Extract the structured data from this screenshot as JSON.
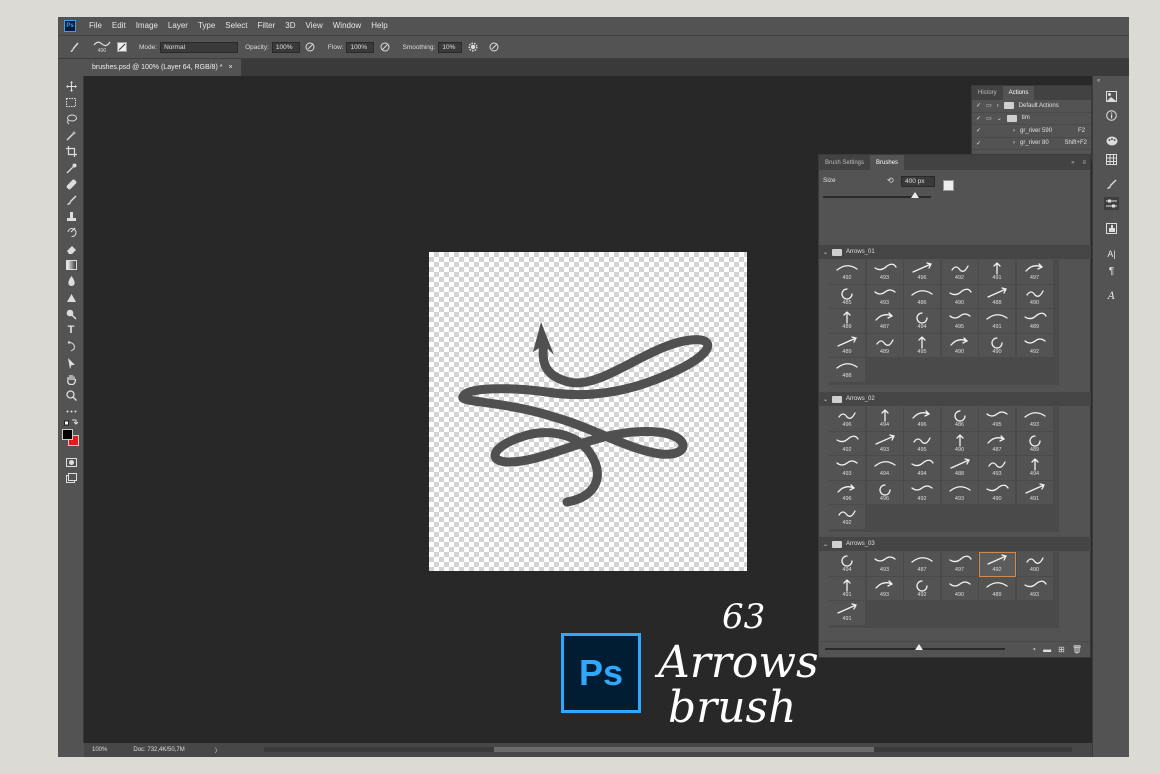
{
  "menubar": {
    "items": [
      "File",
      "Edit",
      "Image",
      "Layer",
      "Type",
      "Select",
      "Filter",
      "3D",
      "View",
      "Window",
      "Help"
    ]
  },
  "options": {
    "brush_size": "400",
    "mode_label": "Mode:",
    "mode_value": "Normal",
    "opacity_label": "Opacity:",
    "opacity_value": "100%",
    "flow_label": "Flow:",
    "flow_value": "100%",
    "smoothing_label": "Smoothing:",
    "smoothing_value": "10%"
  },
  "document_tab": {
    "title": "brushes.psd @ 100% (Layer 64, RGB/8) *",
    "close": "×"
  },
  "status": {
    "zoom": "100%",
    "doc": "Doc: 732,4K/50,7M",
    "arrow": "〉"
  },
  "history_panel": {
    "tabs": [
      "History",
      "Actions"
    ],
    "rows": [
      {
        "label": "Default Actions",
        "shortcut": ""
      },
      {
        "label": "tim",
        "shortcut": ""
      },
      {
        "label": "gr_river 590",
        "shortcut": "F2"
      },
      {
        "label": "gr_river 80",
        "shortcut": "Shift+F2"
      }
    ]
  },
  "brush_panel": {
    "tabs": [
      "Brush Settings",
      "Brushes"
    ],
    "size_label": "Size",
    "size_value": "400 px",
    "groups": [
      {
        "name": "Arrows_01",
        "numbers": [
          "492",
          "493",
          "496",
          "492",
          "491",
          "497",
          "485",
          "493",
          "486",
          "490",
          "488",
          "490",
          "489",
          "487",
          "494",
          "495",
          "491",
          "489",
          "489",
          "489",
          "495",
          "490",
          "490",
          "492",
          "488"
        ]
      },
      {
        "name": "Arrows_02",
        "numbers": [
          "496",
          "494",
          "496",
          "486",
          "495",
          "493",
          "492",
          "493",
          "495",
          "490",
          "487",
          "489",
          "493",
          "494",
          "494",
          "488",
          "493",
          "494",
          "496",
          "496",
          "492",
          "493",
          "490",
          "491",
          "492"
        ]
      },
      {
        "name": "Arrows_03",
        "numbers": [
          "494",
          "493",
          "487",
          "497",
          "492",
          "490",
          "491",
          "493",
          "492",
          "490",
          "489",
          "493",
          "491"
        ]
      }
    ]
  },
  "promo": {
    "ps_label": "Ps",
    "number": "63",
    "script_line1": "Arrows",
    "script_line2": "brush"
  }
}
